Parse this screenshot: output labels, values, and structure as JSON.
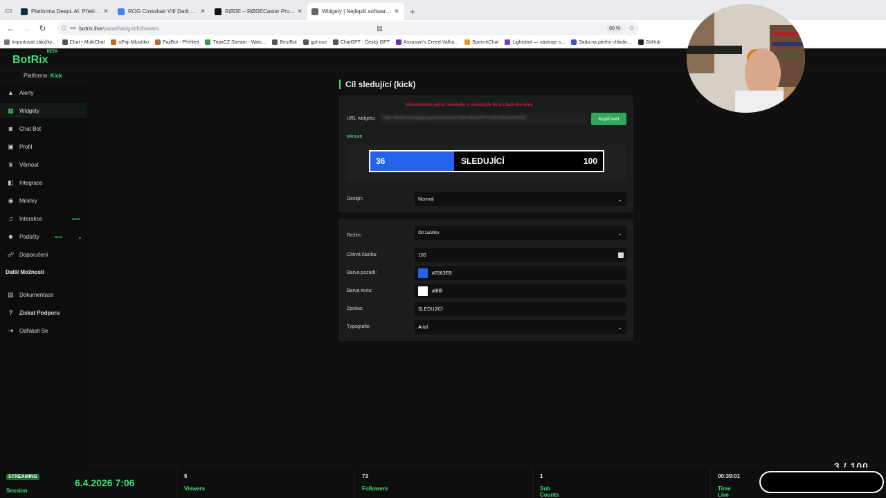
{
  "browser": {
    "tabs": [
      {
        "title": "Platforma DeepL AI: Překlad, hl",
        "color": "#0f2b46",
        "active": false
      },
      {
        "title": "ROG Crosshair VIII Dark Hero - ",
        "color": "#4285f4",
        "active": false
      },
      {
        "title": "RØDE – RØDECaster Pro II and RØD",
        "color": "#111111",
        "active": false
      },
      {
        "title": "Widgety | Nejlepší software pro",
        "color": "#666666",
        "active": true
      }
    ],
    "url_host": "botrix.live",
    "url_path": "/panel/widget/followers",
    "zoom": "80 %",
    "bookmarks": [
      {
        "label": "Importovat záložky...",
        "color": "#777777"
      },
      {
        "label": "Chat • MultiChat",
        "color": "#555555"
      },
      {
        "label": "uPaji Mluvítko",
        "color": "#b07030"
      },
      {
        "label": "PajiBot - Přehled",
        "color": "#b07030"
      },
      {
        "label": "TripxCZ Stream - Watc...",
        "color": "#2f9e44"
      },
      {
        "label": "BestBot",
        "color": "#555555"
      },
      {
        "label": "gpt-oss",
        "color": "#555555"
      },
      {
        "label": "ChatGPT - Český GPT",
        "color": "#555555"
      },
      {
        "label": "Assassin's Creed Valha...",
        "color": "#7a2aa0"
      },
      {
        "label": "SpeechChat",
        "color": "#e69a1a"
      },
      {
        "label": "Lightshot — nástroje s...",
        "color": "#7a3cc8"
      },
      {
        "label": "Sada na plnění chladic...",
        "color": "#3a56c8"
      },
      {
        "label": "GitHub",
        "color": "#222222"
      }
    ]
  },
  "app": {
    "logo": "BotRix",
    "logo_badge": "BETA",
    "platform_label": "Platforma:",
    "platform_value": "Kick",
    "accent": "#3ee07a",
    "sidebar": [
      {
        "label": "Alerty",
        "icon": "warning-icon",
        "glyph": "▲",
        "active": false
      },
      {
        "label": "Widgety",
        "icon": "grid-icon",
        "glyph": "▦",
        "active": true
      },
      {
        "label": "Chat Bot",
        "icon": "robot-icon",
        "glyph": "◙",
        "active": false
      },
      {
        "label": "Profil",
        "icon": "id-card-icon",
        "glyph": "▣",
        "active": false
      },
      {
        "label": "Věrnost",
        "icon": "trophy-icon",
        "glyph": "♛",
        "active": false
      },
      {
        "label": "Integrace",
        "icon": "integration-icon",
        "glyph": "◧",
        "active": false
      },
      {
        "label": "Minihry",
        "icon": "gamepad-icon",
        "glyph": "◉",
        "active": false
      },
      {
        "label": "Interakce",
        "icon": "music-icon",
        "glyph": "♫",
        "active": false,
        "badge": "NOVÉ"
      },
      {
        "label": "Podúčty",
        "icon": "users-icon",
        "glyph": "☻",
        "active": false,
        "badge": "BETA",
        "chevron": "⌄"
      },
      {
        "label": "Doporučení",
        "icon": "referral-icon",
        "glyph": "☍",
        "active": false
      }
    ],
    "more_section": "Další Možnosti",
    "more_items": [
      {
        "label": "Dokumentace",
        "icon": "doc-icon",
        "glyph": "▤"
      },
      {
        "label": "Získat Podporu",
        "icon": "help-icon",
        "glyph": "?"
      },
      {
        "label": "Odhlásit Se",
        "icon": "logout-icon",
        "glyph": "⇥"
      }
    ]
  },
  "page": {
    "title": "Cíl sledující (kick)",
    "warning": "Nikomu tento odkaz nesdílejte a neukazujte ho do žádného okna",
    "url_label": "URL widgetu:",
    "url_value": "https://botrix.live/widgets/goals/followers/?bid=abc5JFfmYwQ%2BmD1XhCbQ",
    "copy_button": "Kopírovat",
    "preview_label": "NÁHLED",
    "preview": {
      "current": "36",
      "text": "SLEDUJÍCÍ",
      "goal": "100",
      "progress": 0.36
    },
    "design_label": "Design:",
    "design_value": "Normal",
    "mode_label": "Režim:",
    "mode_value": "Od začátku",
    "goal_label": "Cílová částka:",
    "goal_value": "100",
    "bg_label": "Barva pozadí:",
    "bg_value": "#2563EB",
    "text_color_label": "Barva textu:",
    "text_color_value": "#ffffff",
    "message_label": "Zpráva:",
    "message_value": "SLEDUJÍCÍ",
    "font_label": "Typografie:",
    "font_value": "Arial"
  },
  "footer": {
    "streaming": "STREAMING",
    "session_label": "Session",
    "datetime": "6.4.2026 7:06",
    "viewers_value": "5",
    "viewers_label": "Viewers",
    "followers_value": "73",
    "followers_label": "Followers",
    "subs_value": "1",
    "subs_label": "Sub Counts",
    "time_value": "00:39:01",
    "time_label": "Time Live",
    "partial_counter": "3 / 100"
  }
}
